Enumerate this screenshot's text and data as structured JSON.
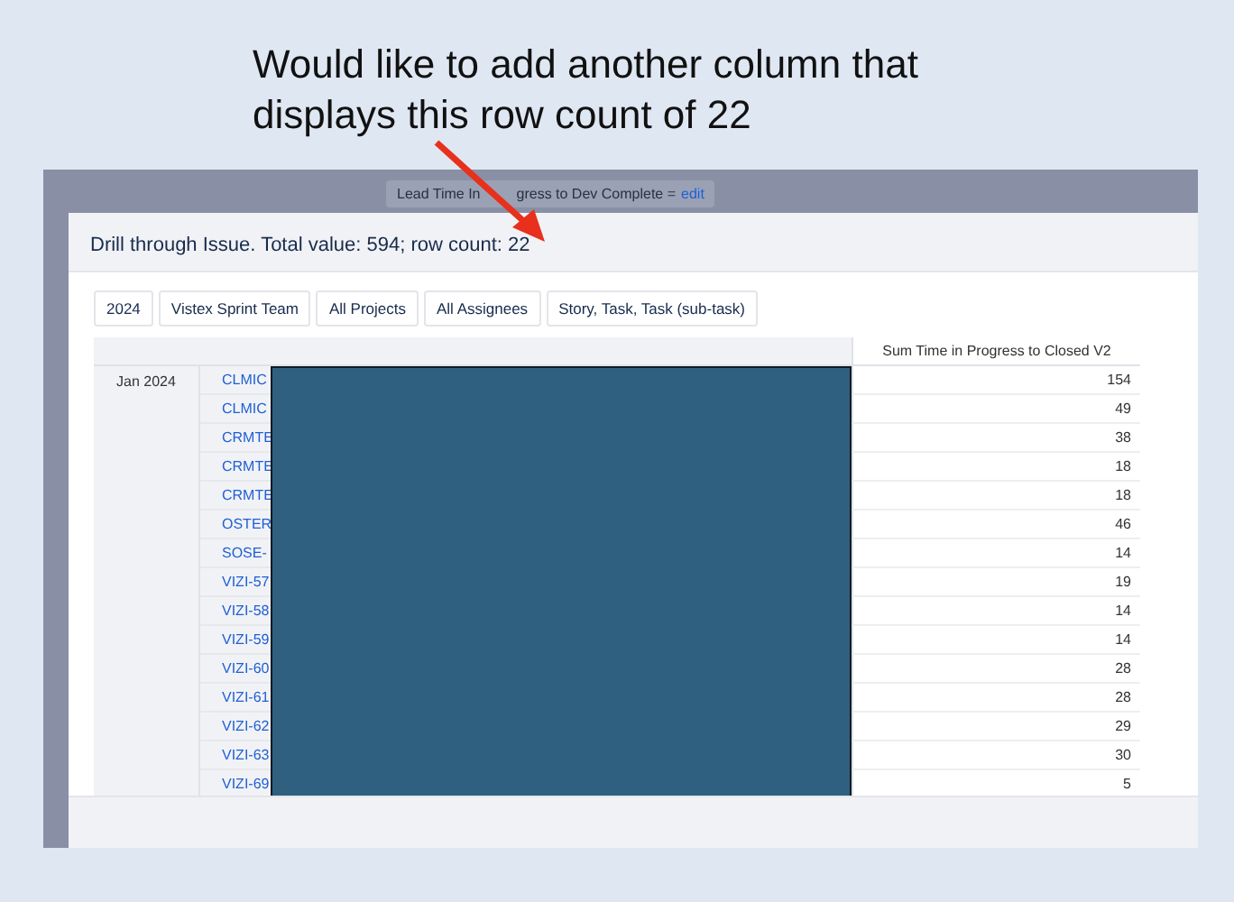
{
  "annotation": "Would like to add another column that displays this row count of 22",
  "background_bar": {
    "label_start": "Lead Time In",
    "label_end": "gress to Dev Complete =",
    "link": "edit"
  },
  "dialog": {
    "title": "Drill through Issue. Total value: 594; row count: 22",
    "filters": [
      "2024",
      "Vistex Sprint Team",
      "All Projects",
      "All Assignees",
      "Story, Task, Task (sub-task)"
    ],
    "table": {
      "value_column": "Sum Time in Progress to Closed V2",
      "group": "Jan 2024",
      "rows": [
        {
          "key": "CLMIC",
          "value": "154"
        },
        {
          "key": "CLMIC",
          "value": "49"
        },
        {
          "key": "CRMTE",
          "value": "38"
        },
        {
          "key": "CRMTE",
          "value": "18"
        },
        {
          "key": "CRMTE",
          "value": "18"
        },
        {
          "key": "OSTER",
          "value": "46"
        },
        {
          "key": "SOSE-",
          "value": "14"
        },
        {
          "key": "VIZI-57",
          "value": "19"
        },
        {
          "key": "VIZI-58",
          "value": "14"
        },
        {
          "key": "VIZI-59",
          "value": "14"
        },
        {
          "key": "VIZI-60",
          "value": "28"
        },
        {
          "key": "VIZI-61",
          "value": "28"
        },
        {
          "key": "VIZI-62",
          "value": "29"
        },
        {
          "key": "VIZI-63",
          "value": "30"
        },
        {
          "key": "VIZI-69",
          "value": "5"
        }
      ]
    }
  }
}
